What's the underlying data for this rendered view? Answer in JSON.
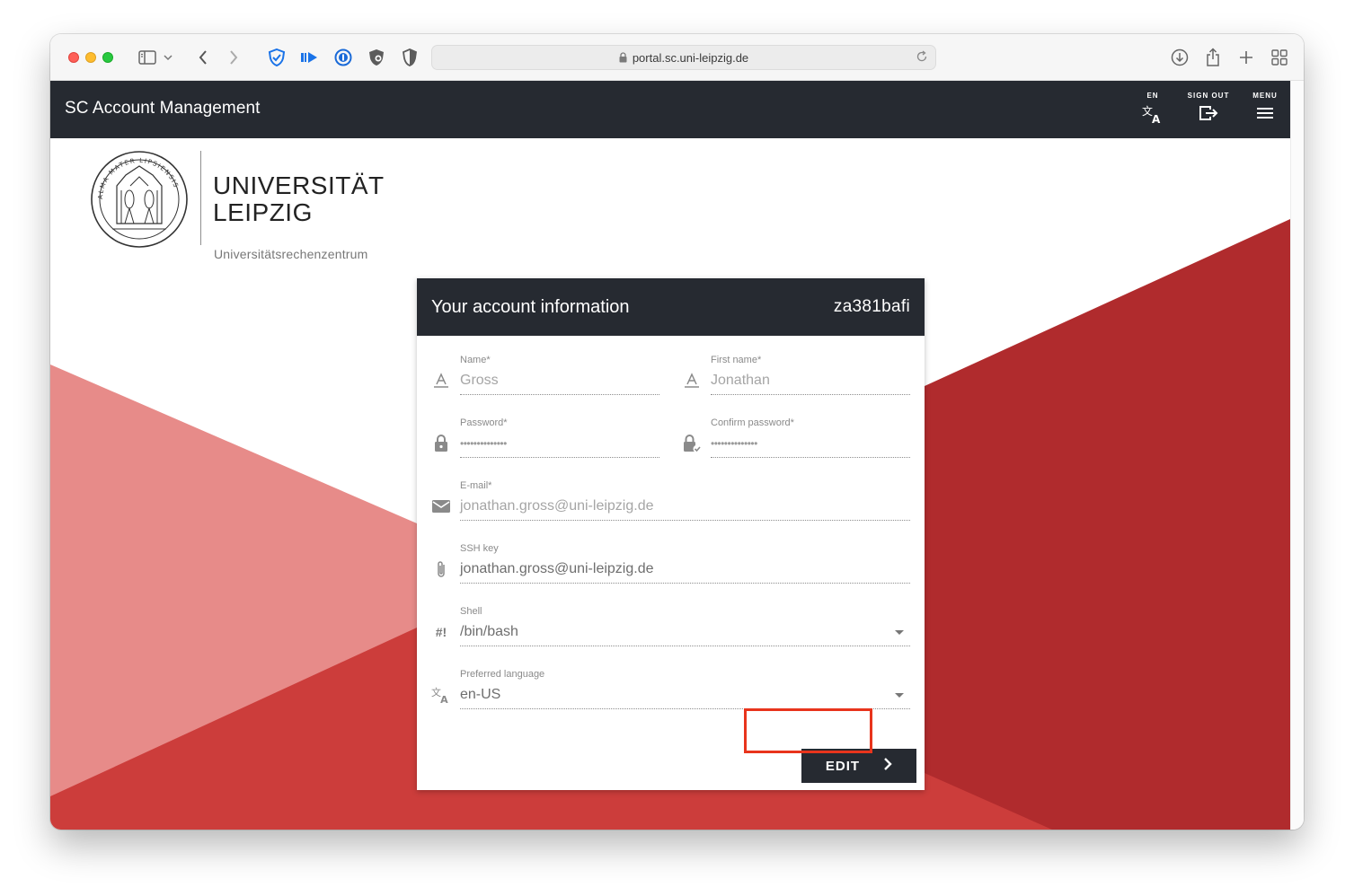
{
  "browser": {
    "url": "portal.sc.uni-leipzig.de",
    "toolbar_icons": [
      "sidebar-icon",
      "chevron-down-icon",
      "back-icon",
      "forward-icon",
      "shield-check-icon",
      "media-icon",
      "password-manager-icon",
      "privacy-shield-icon",
      "contrast-shield-icon",
      "download-icon",
      "share-icon",
      "new-tab-icon",
      "tab-overview-icon"
    ]
  },
  "appbar": {
    "title": "SC Account Management",
    "language_label": "EN",
    "signout_label": "SIGN OUT",
    "menu_label": "MENU"
  },
  "logo": {
    "line1": "UNIVERSITÄT",
    "line2": "LEIPZIG",
    "subtitle": "Universitätsrechenzentrum",
    "seal_text": "ALMA MATER LIPSIENSIS"
  },
  "card": {
    "title": "Your account information",
    "username": "za381bafi",
    "fields": {
      "name": {
        "label": "Name*",
        "value": "Gross",
        "icon": "text-format-icon"
      },
      "first_name": {
        "label": "First name*",
        "value": "Jonathan",
        "icon": "text-format-icon"
      },
      "password": {
        "label": "Password*",
        "value": "••••••••••••••",
        "icon": "lock-icon"
      },
      "confirm_password": {
        "label": "Confirm password*",
        "value": "••••••••••••••",
        "icon": "lock-check-icon"
      },
      "email": {
        "label": "E-mail*",
        "value": "jonathan.gross@uni-leipzig.de",
        "icon": "mail-icon"
      },
      "ssh_key": {
        "label": "SSH key",
        "value": "jonathan.gross@uni-leipzig.de",
        "icon": "paperclip-icon"
      },
      "shell": {
        "label": "Shell",
        "value": "/bin/bash",
        "icon_text": "#!"
      },
      "language": {
        "label": "Preferred language",
        "value": "en-US",
        "icon": "translate-icon"
      }
    },
    "edit_label": "EDIT"
  },
  "colors": {
    "appbar": "#262a31",
    "red_dark": "#b02b2d",
    "red_mid": "#cc3d3b",
    "red_light": "#e78b89",
    "highlight": "#e8341c"
  }
}
